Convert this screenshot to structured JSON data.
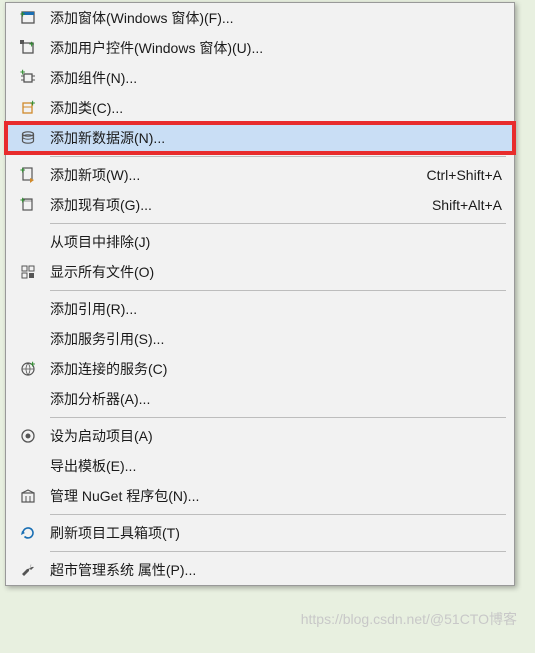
{
  "menu": {
    "items": [
      {
        "id": "add-windows-form",
        "label": "添加窗体(Windows 窗体)(F)...",
        "icon": "form-icon",
        "shortcut": ""
      },
      {
        "id": "add-user-control",
        "label": "添加用户控件(Windows 窗体)(U)...",
        "icon": "user-control-icon",
        "shortcut": ""
      },
      {
        "id": "add-component",
        "label": "添加组件(N)...",
        "icon": "component-icon",
        "shortcut": ""
      },
      {
        "id": "add-class",
        "label": "添加类(C)...",
        "icon": "class-icon",
        "shortcut": ""
      },
      {
        "id": "add-data-source",
        "label": "添加新数据源(N)...",
        "icon": "datasource-icon",
        "shortcut": ""
      },
      {
        "sep": true
      },
      {
        "id": "add-new-item",
        "label": "添加新项(W)...",
        "icon": "new-item-icon",
        "shortcut": "Ctrl+Shift+A"
      },
      {
        "id": "add-existing-item",
        "label": "添加现有项(G)...",
        "icon": "existing-item-icon",
        "shortcut": "Shift+Alt+A"
      },
      {
        "sep": true
      },
      {
        "id": "exclude-from-project",
        "label": "从项目中排除(J)",
        "icon": "",
        "shortcut": ""
      },
      {
        "id": "show-all-files",
        "label": "显示所有文件(O)",
        "icon": "show-all-icon",
        "shortcut": ""
      },
      {
        "sep": true
      },
      {
        "id": "add-reference",
        "label": "添加引用(R)...",
        "icon": "",
        "shortcut": ""
      },
      {
        "id": "add-service-reference",
        "label": "添加服务引用(S)...",
        "icon": "",
        "shortcut": ""
      },
      {
        "id": "add-connected-service",
        "label": "添加连接的服务(C)",
        "icon": "connected-service-icon",
        "shortcut": ""
      },
      {
        "id": "add-analyzer",
        "label": "添加分析器(A)...",
        "icon": "",
        "shortcut": ""
      },
      {
        "sep": true
      },
      {
        "id": "set-as-startup",
        "label": "设为启动项目(A)",
        "icon": "startup-icon",
        "shortcut": ""
      },
      {
        "id": "export-template",
        "label": "导出模板(E)...",
        "icon": "",
        "shortcut": ""
      },
      {
        "id": "manage-nuget",
        "label": "管理 NuGet 程序包(N)...",
        "icon": "nuget-icon",
        "shortcut": ""
      },
      {
        "sep": true
      },
      {
        "id": "refresh-toolbox",
        "label": "刷新项目工具箱项(T)",
        "icon": "refresh-icon",
        "shortcut": ""
      },
      {
        "sep": true
      },
      {
        "id": "properties",
        "label": "超市管理系统 属性(P)...",
        "icon": "wrench-icon",
        "shortcut": ""
      }
    ]
  },
  "highlighted_id": "add-data-source",
  "watermark": "https://blog.csdn.net/@51CTO博客"
}
